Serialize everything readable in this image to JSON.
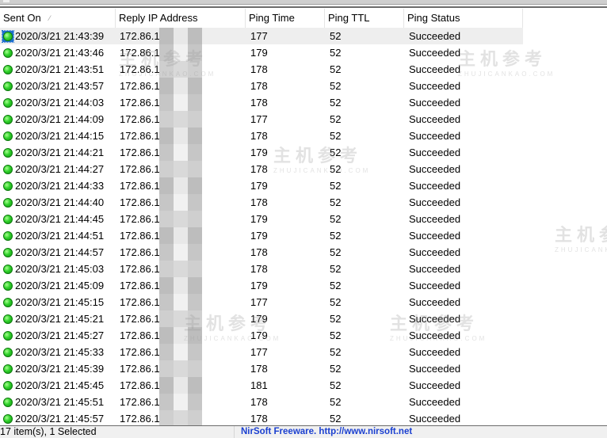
{
  "columns": {
    "sent_on": "Sent On",
    "reply_ip": "Reply IP Address",
    "ping_time": "Ping Time",
    "ping_ttl": "Ping TTL",
    "ping_status": "Ping Status"
  },
  "sort": {
    "column": "sent_on",
    "icon": "sort-ascending-icon",
    "glyph": "⁄"
  },
  "rows": [
    {
      "sent_on": "2020/3/21 21:43:39",
      "reply_ip": "172.86.12",
      "ping_time": "177",
      "ttl": "52",
      "status": "Succeeded",
      "selected": true
    },
    {
      "sent_on": "2020/3/21 21:43:46",
      "reply_ip": "172.86.12",
      "ping_time": "179",
      "ttl": "52",
      "status": "Succeeded"
    },
    {
      "sent_on": "2020/3/21 21:43:51",
      "reply_ip": "172.86.12",
      "ping_time": "178",
      "ttl": "52",
      "status": "Succeeded"
    },
    {
      "sent_on": "2020/3/21 21:43:57",
      "reply_ip": "172.86.12",
      "ping_time": "178",
      "ttl": "52",
      "status": "Succeeded"
    },
    {
      "sent_on": "2020/3/21 21:44:03",
      "reply_ip": "172.86.1",
      "ping_time": "178",
      "ttl": "52",
      "status": "Succeeded"
    },
    {
      "sent_on": "2020/3/21 21:44:09",
      "reply_ip": "172.86.1",
      "ping_time": "177",
      "ttl": "52",
      "status": "Succeeded"
    },
    {
      "sent_on": "2020/3/21 21:44:15",
      "reply_ip": "172.86.1",
      "ping_time": "178",
      "ttl": "52",
      "status": "Succeeded"
    },
    {
      "sent_on": "2020/3/21 21:44:21",
      "reply_ip": "172.86.1",
      "ping_time": "179",
      "ttl": "52",
      "status": "Succeeded"
    },
    {
      "sent_on": "2020/3/21 21:44:27",
      "reply_ip": "172.86.1",
      "ping_time": "178",
      "ttl": "52",
      "status": "Succeeded"
    },
    {
      "sent_on": "2020/3/21 21:44:33",
      "reply_ip": "172.86.1",
      "ping_time": "179",
      "ttl": "52",
      "status": "Succeeded"
    },
    {
      "sent_on": "2020/3/21 21:44:40",
      "reply_ip": "172.86.1",
      "ping_time": "178",
      "ttl": "52",
      "status": "Succeeded"
    },
    {
      "sent_on": "2020/3/21 21:44:45",
      "reply_ip": "172.86.1",
      "ping_time": "179",
      "ttl": "52",
      "status": "Succeeded"
    },
    {
      "sent_on": "2020/3/21 21:44:51",
      "reply_ip": "172.86.1",
      "ping_time": "179",
      "ttl": "52",
      "status": "Succeeded"
    },
    {
      "sent_on": "2020/3/21 21:44:57",
      "reply_ip": "172.86.1",
      "ping_time": "178",
      "ttl": "52",
      "status": "Succeeded"
    },
    {
      "sent_on": "2020/3/21 21:45:03",
      "reply_ip": "172.86.1",
      "ping_time": "178",
      "ttl": "52",
      "status": "Succeeded"
    },
    {
      "sent_on": "2020/3/21 21:45:09",
      "reply_ip": "172.86.1",
      "ping_time": "179",
      "ttl": "52",
      "status": "Succeeded"
    },
    {
      "sent_on": "2020/3/21 21:45:15",
      "reply_ip": "172.86.1",
      "ping_time": "177",
      "ttl": "52",
      "status": "Succeeded"
    },
    {
      "sent_on": "2020/3/21 21:45:21",
      "reply_ip": "172.86.1",
      "ping_time": "179",
      "ttl": "52",
      "status": "Succeeded"
    },
    {
      "sent_on": "2020/3/21 21:45:27",
      "reply_ip": "172.86.1",
      "ping_time": "179",
      "ttl": "52",
      "status": "Succeeded"
    },
    {
      "sent_on": "2020/3/21 21:45:33",
      "reply_ip": "172.86.1",
      "ping_time": "177",
      "ttl": "52",
      "status": "Succeeded"
    },
    {
      "sent_on": "2020/3/21 21:45:39",
      "reply_ip": "172.86.12",
      "ping_time": "178",
      "ttl": "52",
      "status": "Succeeded"
    },
    {
      "sent_on": "2020/3/21 21:45:45",
      "reply_ip": "172.86.12",
      "ping_time": "181",
      "ttl": "52",
      "status": "Succeeded"
    },
    {
      "sent_on": "2020/3/21 21:45:51",
      "reply_ip": "172.86.12",
      "ping_time": "178",
      "ttl": "52",
      "status": "Succeeded"
    },
    {
      "sent_on": "2020/3/21 21:45:57",
      "reply_ip": "172.86.1",
      "ping_time": "178",
      "ttl": "52",
      "status": "Succeeded"
    }
  ],
  "row_icon": "green-status-dot-icon",
  "watermark": {
    "text": "主机参考",
    "sub": "ZHUJICANKAO.COM"
  },
  "statusbar": {
    "items_text": "17 item(s), 1 Selected",
    "credit_text": "NirSoft Freeware.  http://www.nirsoft.net"
  },
  "colors": {
    "status_link": "#1a3fd0",
    "ok_dot": "#2fd12a",
    "selected_row": "#eeeeee"
  }
}
